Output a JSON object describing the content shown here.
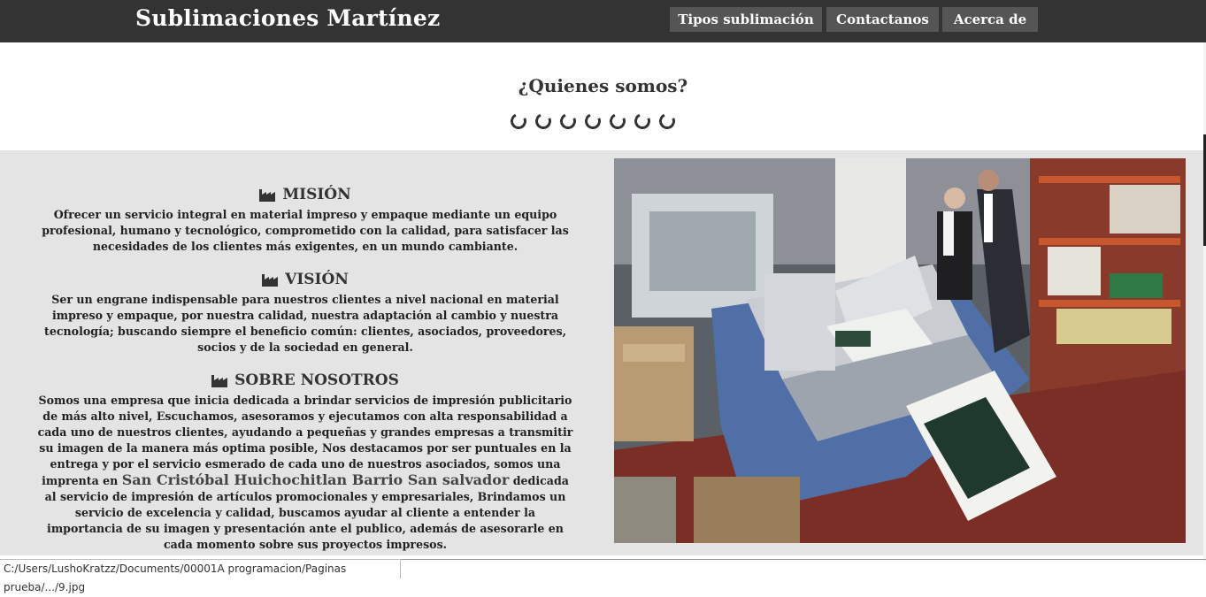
{
  "header": {
    "brand": "Sublimaciones Martínez",
    "nav": [
      {
        "label": "Tipos sublimación"
      },
      {
        "label": "Contactanos"
      },
      {
        "label": "Acerca de"
      }
    ]
  },
  "hero": {
    "title": "¿Quienes somos?",
    "loader_count": 7
  },
  "sections": {
    "mision": {
      "title": "MISIÓN",
      "icon": "factory-icon",
      "text": "Ofrecer un servicio integral en material impreso y empaque mediante un equipo profesional, humano y tecnológico, comprometido con la calidad, para satisfacer las necesidades de los clientes más exigentes, en un mundo cambiante."
    },
    "vision": {
      "title": "VISIÓN",
      "icon": "factory-icon",
      "text": "Ser un engrane indispensable para nuestros clientes a nivel nacional en material impreso y empaque, por nuestra calidad, nuestra adaptación al cambio y nuestra tecnología; buscando siempre el beneficio común: clientes, asociados, proveedores, socios y de la sociedad en general."
    },
    "sobre": {
      "title": "SOBRE NOSOTROS",
      "icon": "factory-icon",
      "text_part1": "Somos una empresa que inicia dedicada a brindar servicios de impresión publicitario de más alto nivel, Escuchamos, asesoramos y ejecutamos con alta responsabilidad a cada uno de nuestros clientes, ayudando a pequeñas y grandes empresas a transmitir su imagen de la manera más optima posible, Nos destacamos por ser puntuales en la entrega y por el servicio esmerado de cada uno de nuestros asociados, somos una imprenta en ",
      "text_highlight": "San Cristóbal Huichochitlan Barrio San salvador",
      "text_part2": " dedicada al servicio de impresión de artículos promocionales y empresariales, Brindamos un servicio de excelencia y calidad, buscamos ayudar al cliente a entender la importancia de su imagen y presentación ante el publico, además de asesorarle en cada momento sobre sus proyectos impresos."
    }
  },
  "status_bar": {
    "url": "C:/Users/LushoKratzz/Documents/00001A programacion/Paginas prueba/.../9.jpg"
  }
}
